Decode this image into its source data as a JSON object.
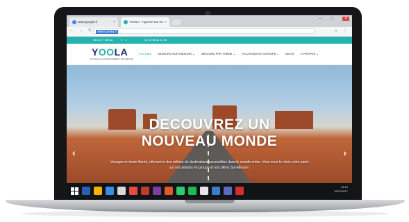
{
  "browser": {
    "tabs": [
      {
        "label": "www.google.fr",
        "favicon_color": "#4285f4",
        "active": false
      },
      {
        "label": "YOOLA - Agence Sur-M...",
        "favicon_color": "#23b4b0",
        "active": true
      }
    ],
    "close_tab_glyph": "×",
    "url": "www.yoola.fr",
    "nav_glyphs": "← → C",
    "window_controls": "– □",
    "window_close": "×",
    "right_icons": "☆ ⋮"
  },
  "site": {
    "topbar": {
      "lang": "SELECT MENU",
      "social": "f t",
      "phone": "04 69 96 64 45 50"
    },
    "logo": {
      "prefix": "Y",
      "accent": "OO",
      "suffix": "LA"
    },
    "tagline": "VOYAGES & ACCOMPAGNEMENT SUR-MESURE",
    "menu": [
      {
        "label": "ACCUEIL",
        "active": true
      },
      {
        "label": "SÉJOURS SUR MESURE ⌄",
        "active": false
      },
      {
        "label": "SÉJOURS PAR THÈME ⌄",
        "active": false
      },
      {
        "label": "VACANCES EN GROUPE ⌄",
        "active": false
      },
      {
        "label": "DEVIS",
        "active": false
      },
      {
        "label": "A PROPOS ⌄",
        "active": false
      }
    ],
    "hero": {
      "title_line1": "DECOUVREZ UN",
      "title_line2": "NOUVEAU MONDE",
      "subtitle": "Voyagez en toute liberté, découvrez des milliers de destinations accessibles dans le monde entier. Vous avez le choix entre partir sur nos séjours en groupe et nos offres Sur-Mesure.",
      "prev_glyph": "‹",
      "next_glyph": "›"
    }
  },
  "taskbar": {
    "time": "15:12",
    "date": "12/01/2017",
    "icon_colors": [
      "#2b5fb4",
      "#f4b400",
      "#3a8ee6",
      "#d8d8d8",
      "#e94a3f",
      "#c0392b",
      "#7b3fa0",
      "#e05a2a",
      "#2ecc71",
      "#1db954",
      "#e6e6e6",
      "#3d7cc9",
      "#5c6bc0",
      "#d32f2f"
    ]
  },
  "colors": {
    "accent": "#23b4b0",
    "brand": "#1b2a6b"
  }
}
